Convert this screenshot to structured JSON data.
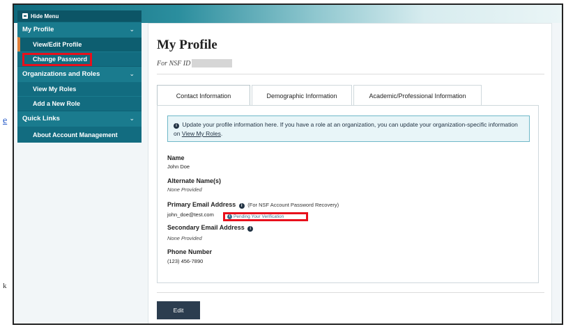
{
  "edge": {
    "link_glyph": "e",
    "mark_glyph": "k"
  },
  "sidebar": {
    "hide_menu": "Hide Menu",
    "sections": [
      {
        "label": "My Profile",
        "items": [
          "View/Edit Profile",
          "Change Password"
        ]
      },
      {
        "label": "Organizations and Roles",
        "items": [
          "View My Roles",
          "Add a New Role"
        ]
      },
      {
        "label": "Quick Links",
        "items": [
          "About Account Management"
        ]
      }
    ],
    "active_item": "View/Edit Profile",
    "highlighted_item": "Change Password"
  },
  "main": {
    "title": "My Profile",
    "nsf_id_label": "For NSF ID",
    "tabs": [
      "Contact Information",
      "Demographic Information",
      "Academic/Professional Information"
    ],
    "active_tab": "Contact Information",
    "info_text": "Update your profile information here. If you have a role at an organization, you can update your organization-specific information on",
    "info_link": "View My Roles",
    "info_end": ".",
    "fields": {
      "name_label": "Name",
      "name_value": "John Doe",
      "alt_name_label": "Alternate Name(s)",
      "alt_name_value": "None Provided",
      "primary_email_label": "Primary Email Address",
      "primary_email_note": "(For NSF Account Password Recovery)",
      "primary_email_value": "john_doe@test.com",
      "pending_text": "Pending Your Verification",
      "secondary_email_label": "Secondary Email Address",
      "secondary_email_value": "None Provided",
      "phone_label": "Phone Number",
      "phone_value": "(123) 456-7890"
    },
    "edit_button": "Edit"
  },
  "colors": {
    "sidebar_bg": "#126c80",
    "highlight_red": "#e8101c",
    "active_accent": "#e0803a",
    "button_bg": "#2c3d4f"
  }
}
